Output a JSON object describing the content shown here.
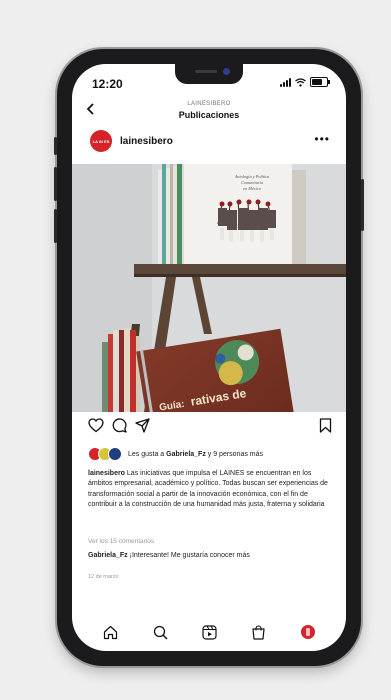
{
  "status_bar": {
    "time": "12:20"
  },
  "header": {
    "username": "LAINESIBERO",
    "title": "Publicaciones"
  },
  "post": {
    "avatar_text": "LA IN ES",
    "username": "lainesibero",
    "likes_prefix": "Les gusta a ",
    "likes_user": "Gabriela_Fz",
    "likes_suffix": " y 9 personas más",
    "caption_user": "lainesibero",
    "caption_text": " Las iniciativas que impulsa el LAINES se encuentran en los ámbitos empresarial, académico y político. Todas buscan ser experiencias de transformación social a partir de la innovación económica, con el fin de contribuir a la construcción de una humanidad más justa, fraterna y solidaria",
    "view_comments": "Ver los 15 comentarios",
    "comment_user": "Gabriela_Fz",
    "comment_text": " ¡Interesante! Me gustaría conocer más",
    "date": "12 de marzo"
  },
  "colors": {
    "brand_red": "#d6232a"
  },
  "icons": {
    "actions": [
      "heart-icon",
      "comment-icon",
      "share-icon",
      "bookmark-icon"
    ],
    "tabbar": [
      "home-icon",
      "search-icon",
      "reels-icon",
      "shop-icon",
      "profile-icon"
    ]
  }
}
